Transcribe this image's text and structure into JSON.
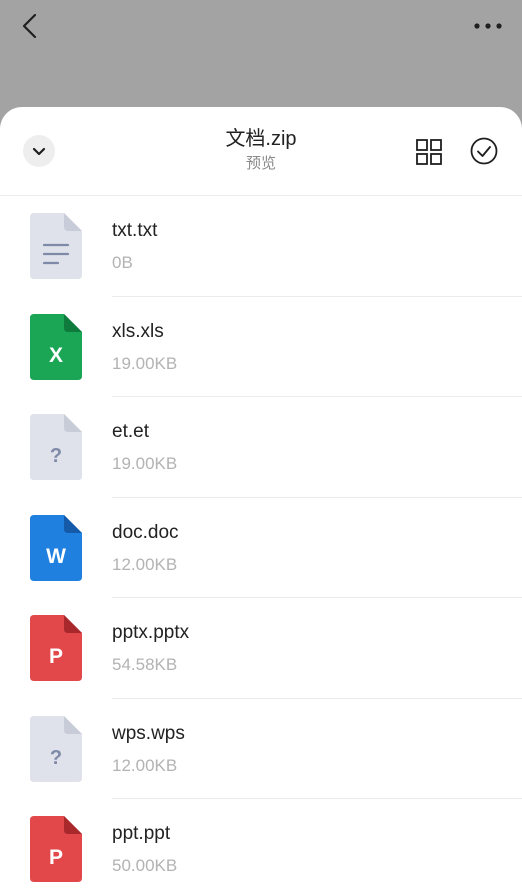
{
  "sheet": {
    "title": "文档.zip",
    "subtitle": "预览"
  },
  "icons": {
    "back": "back-chevron-icon",
    "more": "more-dots-icon",
    "collapse": "chevron-down-icon",
    "grid": "grid-view-icon",
    "select": "check-circle-icon"
  },
  "colors": {
    "overlay": "#a3a3a3",
    "sheet_bg": "#ffffff",
    "text_file_icon": "#dfe2ea",
    "text_file_fold": "#c7ccd8",
    "excel": "#1aa654",
    "excel_fold": "#0e7a3c",
    "word": "#1f80e0",
    "word_fold": "#145aa8",
    "ppt": "#e2474a",
    "ppt_fold": "#a8282b",
    "unknown": "#dfe2ea",
    "unknown_fold": "#c7ccd8",
    "unknown_glyph": "#7f8aa8"
  },
  "files": [
    {
      "name": "txt.txt",
      "size": "0B",
      "type": "text",
      "glyph": ""
    },
    {
      "name": "xls.xls",
      "size": "19.00KB",
      "type": "excel",
      "glyph": "X"
    },
    {
      "name": "et.et",
      "size": "19.00KB",
      "type": "unknown",
      "glyph": "?"
    },
    {
      "name": "doc.doc",
      "size": "12.00KB",
      "type": "word",
      "glyph": "W"
    },
    {
      "name": "pptx.pptx",
      "size": "54.58KB",
      "type": "ppt",
      "glyph": "P"
    },
    {
      "name": "wps.wps",
      "size": "12.00KB",
      "type": "unknown",
      "glyph": "?"
    },
    {
      "name": "ppt.ppt",
      "size": "50.00KB",
      "type": "ppt",
      "glyph": "P"
    }
  ]
}
